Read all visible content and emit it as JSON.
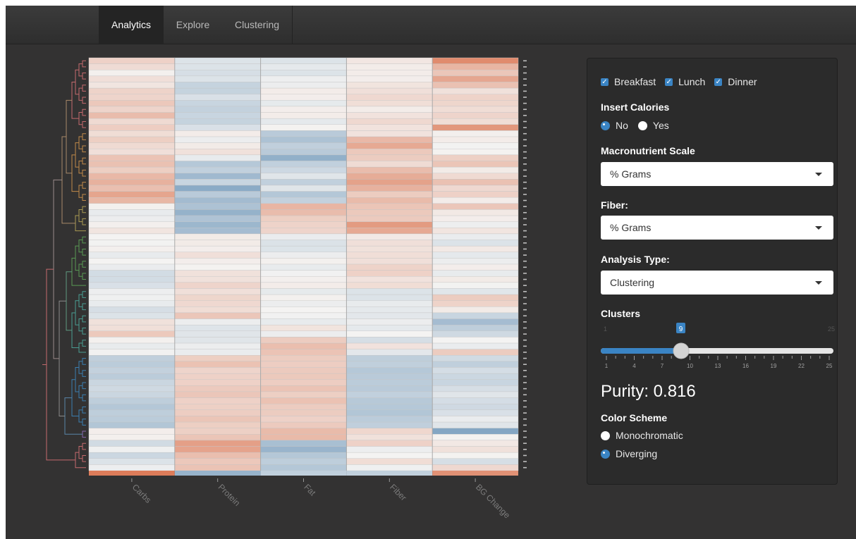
{
  "navbar": {
    "tabs": [
      {
        "label": "Analytics",
        "active": true
      },
      {
        "label": "Explore",
        "active": false
      },
      {
        "label": "Clustering",
        "active": false
      }
    ]
  },
  "chart_data": {
    "type": "heatmap",
    "columns": [
      "Carbs",
      "Protein",
      "Fat",
      "Fiber",
      "BG Change"
    ],
    "rows": 68,
    "value_range": [
      -1,
      1
    ],
    "color_scheme": "diverging",
    "colors": {
      "negative": "#4b7fab",
      "neutral": "#f4f3f2",
      "positive": "#d9673f"
    },
    "cell_values": [
      [
        0.24,
        -0.14,
        -0.14,
        0.09,
        0.74
      ],
      [
        0.17,
        -0.14,
        -0.09,
        0.05,
        0.44
      ],
      [
        0.02,
        -0.18,
        -0.14,
        0.05,
        0.32
      ],
      [
        0.14,
        -0.14,
        -0.04,
        0.04,
        0.55
      ],
      [
        0.1,
        -0.28,
        -0.05,
        0.11,
        0.36
      ],
      [
        0.23,
        -0.28,
        0.05,
        0.14,
        0.13
      ],
      [
        0.22,
        -0.16,
        0.04,
        0.19,
        0.23
      ],
      [
        0.31,
        -0.26,
        -0.08,
        0.15,
        0.21
      ],
      [
        0.22,
        -0.29,
        0.04,
        0.05,
        0.16
      ],
      [
        0.39,
        -0.26,
        0.05,
        0.12,
        0.22
      ],
      [
        0.18,
        -0.28,
        -0.09,
        0.19,
        0.16
      ],
      [
        0.27,
        -0.16,
        0.01,
        0.12,
        0.66
      ],
      [
        0.16,
        0.05,
        -0.35,
        0.12,
        0.03
      ],
      [
        0.26,
        -0.05,
        -0.42,
        0.42,
        0.05
      ],
      [
        0.18,
        0.06,
        -0.31,
        0.53,
        -0.01
      ],
      [
        0.14,
        0.13,
        -0.35,
        0.3,
        0.01
      ],
      [
        0.34,
        -0.07,
        -0.58,
        0.28,
        0.25
      ],
      [
        0.36,
        -0.37,
        -0.3,
        0.17,
        0.33
      ],
      [
        0.26,
        -0.3,
        -0.23,
        0.39,
        0.06
      ],
      [
        0.42,
        -0.5,
        -0.12,
        0.51,
        0.18
      ],
      [
        0.47,
        -0.26,
        -0.3,
        0.58,
        0.36
      ],
      [
        0.37,
        -0.62,
        -0.12,
        0.47,
        0.19
      ],
      [
        0.56,
        -0.35,
        -0.38,
        0.28,
        0.24
      ],
      [
        0.43,
        -0.48,
        -0.29,
        0.4,
        0.05
      ],
      [
        0.02,
        -0.42,
        0.44,
        0.33,
        0.32
      ],
      [
        -0.07,
        -0.56,
        0.39,
        0.3,
        0.07
      ],
      [
        -0.05,
        -0.41,
        0.26,
        0.29,
        0.04
      ],
      [
        0.03,
        -0.52,
        0.23,
        0.63,
        -0.04
      ],
      [
        0.1,
        -0.47,
        0.22,
        0.53,
        0.1
      ],
      [
        0.0,
        0.06,
        -0.06,
        0.07,
        -0.06
      ],
      [
        -0.01,
        0.06,
        -0.15,
        0.14,
        -0.14
      ],
      [
        0.03,
        0.04,
        -0.14,
        0.13,
        0.07
      ],
      [
        -0.07,
        0.14,
        -0.05,
        0.15,
        -0.09
      ],
      [
        0.0,
        0.04,
        0.02,
        0.14,
        -0.05
      ],
      [
        -0.06,
        0.01,
        -0.07,
        0.23,
        0.04
      ],
      [
        -0.2,
        0.13,
        -0.02,
        0.24,
        -0.07
      ],
      [
        -0.2,
        0.13,
        0.03,
        0.12,
        0.06
      ],
      [
        -0.16,
        0.22,
        0.05,
        0.16,
        -0.01
      ],
      [
        -0.04,
        0.14,
        -0.08,
        -0.14,
        -0.11
      ],
      [
        -0.03,
        0.21,
        0.02,
        -0.14,
        0.28
      ],
      [
        -0.07,
        0.19,
        -0.05,
        -0.07,
        0.23
      ],
      [
        -0.18,
        0.16,
        0.0,
        -0.09,
        0.06
      ],
      [
        -0.14,
        0.32,
        -0.02,
        -0.1,
        -0.26
      ],
      [
        0.13,
        -0.05,
        -0.07,
        -0.05,
        -0.47
      ],
      [
        0.14,
        -0.13,
        0.11,
        -0.09,
        -0.32
      ],
      [
        0.3,
        -0.12,
        -0.05,
        0.0,
        -0.22
      ],
      [
        0.02,
        -0.12,
        0.28,
        -0.18,
        0.0
      ],
      [
        -0.07,
        -0.05,
        0.38,
        0.12,
        -0.06
      ],
      [
        -0.02,
        -0.06,
        0.34,
        -0.1,
        0.28
      ],
      [
        -0.31,
        0.26,
        0.28,
        -0.32,
        -0.21
      ],
      [
        -0.34,
        0.35,
        0.27,
        -0.31,
        -0.31
      ],
      [
        -0.29,
        0.22,
        0.29,
        -0.37,
        -0.19
      ],
      [
        -0.34,
        0.24,
        0.3,
        -0.35,
        -0.24
      ],
      [
        -0.25,
        0.24,
        0.27,
        -0.34,
        -0.26
      ],
      [
        -0.22,
        0.29,
        0.34,
        -0.35,
        -0.18
      ],
      [
        -0.25,
        0.32,
        0.26,
        -0.3,
        -0.12
      ],
      [
        -0.32,
        0.24,
        0.35,
        -0.36,
        -0.19
      ],
      [
        -0.38,
        0.25,
        0.28,
        -0.37,
        -0.22
      ],
      [
        -0.32,
        0.27,
        0.28,
        -0.39,
        -0.16
      ],
      [
        -0.34,
        0.33,
        0.24,
        -0.34,
        -0.06
      ],
      [
        -0.39,
        0.26,
        0.29,
        -0.31,
        -0.12
      ],
      [
        0.04,
        0.25,
        0.4,
        0.2,
        -0.66
      ],
      [
        0.03,
        0.33,
        0.41,
        0.13,
        0.01
      ],
      [
        -0.21,
        0.6,
        -0.45,
        0.24,
        0.08
      ],
      [
        -0.03,
        0.57,
        -0.54,
        -0.04,
        0.13
      ],
      [
        -0.24,
        0.38,
        -0.38,
        -0.0,
        0.01
      ],
      [
        -0.14,
        0.31,
        -0.32,
        0.16,
        -0.18
      ],
      [
        -0.04,
        0.34,
        -0.38,
        -0.03,
        0.19
      ]
    ],
    "footer_values": [
      0.85,
      -0.55,
      -0.3,
      -0.3,
      0.7
    ],
    "dendrogram_branch_colors": [
      "#c46a6d",
      "#c28a49",
      "#aa9a53",
      "#5a9a54",
      "#4a9d93",
      "#3b7fb0",
      "#8a67ad",
      "#c46a6d"
    ],
    "legend": "none"
  },
  "panel": {
    "meals": [
      {
        "label": "Breakfast",
        "checked": true
      },
      {
        "label": "Lunch",
        "checked": true
      },
      {
        "label": "Dinner",
        "checked": true
      }
    ],
    "insert_calories": {
      "label": "Insert Calories",
      "options": [
        {
          "label": "No",
          "selected": true
        },
        {
          "label": "Yes",
          "selected": false
        }
      ]
    },
    "macronutrient_scale": {
      "label": "Macronutrient Scale",
      "value": "% Grams"
    },
    "fiber": {
      "label": "Fiber:",
      "value": "% Grams"
    },
    "analysis_type": {
      "label": "Analysis Type:",
      "value": "Clustering"
    },
    "clusters": {
      "label": "Clusters",
      "value": "9",
      "min": "1",
      "max": "25",
      "ticks": [
        "1",
        "4",
        "7",
        "10",
        "13",
        "16",
        "19",
        "22",
        "25"
      ]
    },
    "purity": "Purity: 0.816",
    "color_scheme": {
      "label": "Color Scheme",
      "options": [
        {
          "label": "Monochromatic",
          "selected": false
        },
        {
          "label": "Diverging",
          "selected": true
        }
      ]
    }
  }
}
